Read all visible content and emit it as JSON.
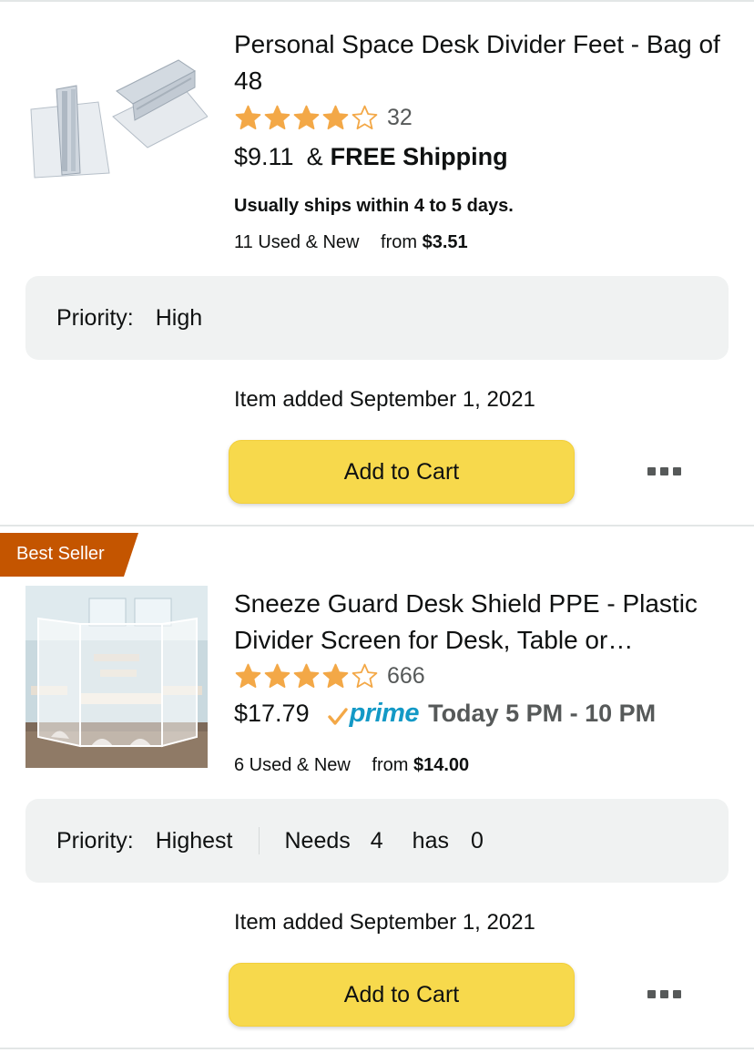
{
  "items": [
    {
      "title": "Personal Space Desk Divider Feet - Bag of 48",
      "rating": 4.0,
      "rating_count": "32",
      "price": "$9.11",
      "amp": "&",
      "free_shipping": "FREE Shipping",
      "ships_note": "Usually ships within 4 to 5 days.",
      "used_new": "11 Used & New",
      "from_label": "from",
      "from_price": "$3.51",
      "priority_label": "Priority:",
      "priority_value": "High",
      "added": "Item added September 1, 2021",
      "cart_label": "Add to Cart"
    },
    {
      "badge": "Best Seller",
      "title_line1": "Sneeze Guard Desk Shield PPE - Plastic",
      "title_line2": "Divider Screen for Desk, Table or…",
      "rating": 4.0,
      "rating_count": "666",
      "price": "$17.79",
      "prime_label": "prime",
      "delivery": "Today 5 PM - 10 PM",
      "used_new": "6 Used & New",
      "from_label": "from",
      "from_price": "$14.00",
      "priority_label": "Priority:",
      "priority_value": "Highest",
      "needs_label": "Needs",
      "needs_value": "4",
      "has_label": "has",
      "has_value": "0",
      "added": "Item added September 1, 2021",
      "cart_label": "Add to Cart"
    }
  ],
  "colors": {
    "star": "#f3a847",
    "cart_button": "#f7d94c",
    "badge": "#c45500",
    "prime_blue": "#1399c6",
    "prime_check": "#f3a847",
    "priority_bg": "#f0f2f2"
  },
  "icons": [
    "star-icon",
    "more-options-icon",
    "prime-check-icon"
  ]
}
